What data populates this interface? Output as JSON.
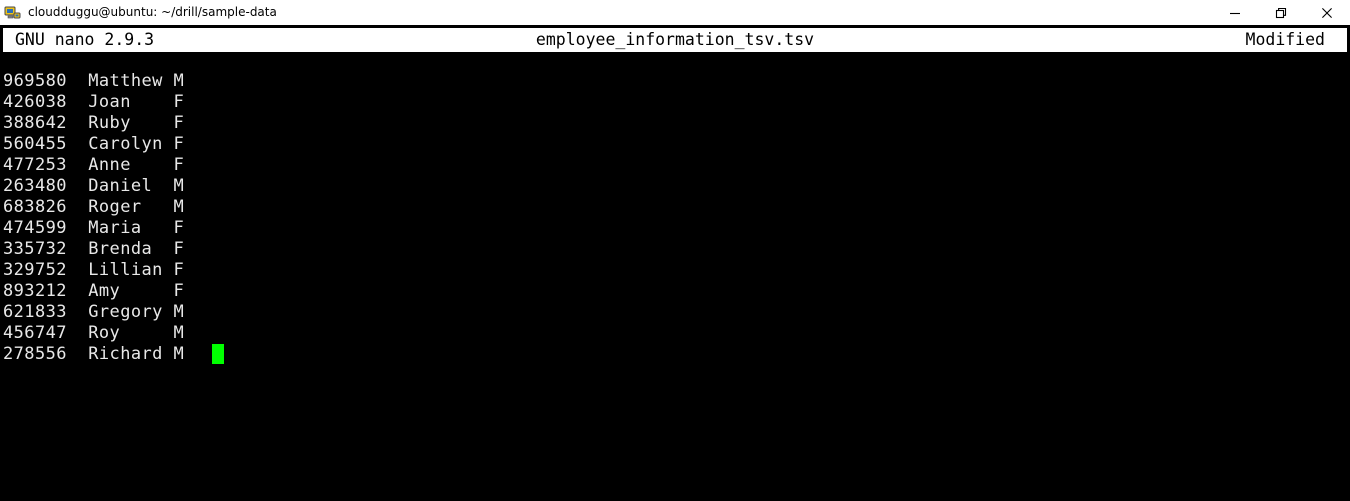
{
  "window": {
    "title": "cloudduggu@ubuntu: ~/drill/sample-data",
    "icon": "terminal-icon",
    "controls": {
      "minimize": "minimize-icon",
      "maximize": "maximize-icon",
      "close": "close-icon"
    }
  },
  "nano": {
    "version_label": "GNU nano 2.9.3",
    "filename": "employee_information_tsv.tsv",
    "status": "Modified"
  },
  "editor": {
    "colors": {
      "background": "#000000",
      "foreground": "#e8e8e8",
      "cursor": "#00ff00",
      "titlebar_bg": "#ffffff",
      "header_bg": "#ffffff",
      "header_fg": "#000000"
    },
    "cursor": {
      "row": 14,
      "column": 16
    },
    "columns": [
      "id",
      "name",
      "gender"
    ],
    "rows": [
      {
        "id": "969580",
        "name": "Matthew",
        "gender": "M",
        "text": "969580  Matthew M"
      },
      {
        "id": "426038",
        "name": "Joan",
        "gender": "F",
        "text": "426038  Joan    F"
      },
      {
        "id": "388642",
        "name": "Ruby",
        "gender": "F",
        "text": "388642  Ruby    F"
      },
      {
        "id": "560455",
        "name": "Carolyn",
        "gender": "F",
        "text": "560455  Carolyn F"
      },
      {
        "id": "477253",
        "name": "Anne",
        "gender": "F",
        "text": "477253  Anne    F"
      },
      {
        "id": "263480",
        "name": "Daniel",
        "gender": "M",
        "text": "263480  Daniel  M"
      },
      {
        "id": "683826",
        "name": "Roger",
        "gender": "M",
        "text": "683826  Roger   M"
      },
      {
        "id": "474599",
        "name": "Maria",
        "gender": "F",
        "text": "474599  Maria   F"
      },
      {
        "id": "335732",
        "name": "Brenda",
        "gender": "F",
        "text": "335732  Brenda  F"
      },
      {
        "id": "329752",
        "name": "Lillian",
        "gender": "F",
        "text": "329752  Lillian F"
      },
      {
        "id": "893212",
        "name": "Amy",
        "gender": "F",
        "text": "893212  Amy     F"
      },
      {
        "id": "621833",
        "name": "Gregory",
        "gender": "M",
        "text": "621833  Gregory M"
      },
      {
        "id": "456747",
        "name": "Roy",
        "gender": "M",
        "text": "456747  Roy     M"
      },
      {
        "id": "278556",
        "name": "Richard",
        "gender": "M",
        "text": "278556  Richard M"
      }
    ]
  }
}
